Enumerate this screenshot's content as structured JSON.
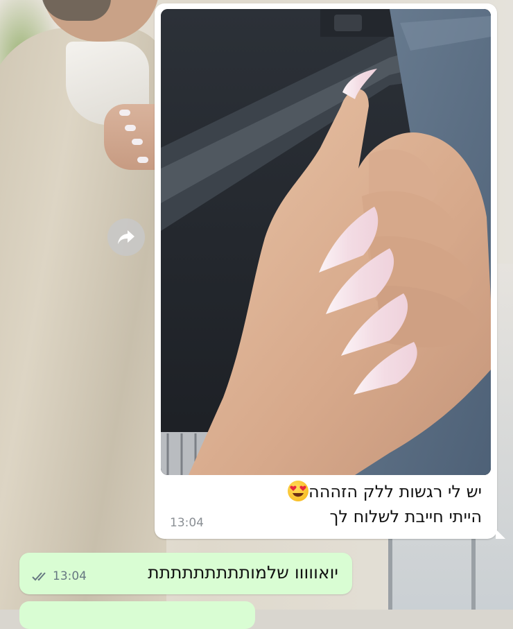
{
  "incoming": {
    "caption_line1": "יש לי רגשות ללק הזההה",
    "caption_line2": "הייתי חייבת לשלוח לך",
    "time": "13:04",
    "emoji": "heart-eyes-emoji"
  },
  "outgoing": {
    "text": "יואווווו שלמותתתתתתתתת",
    "time": "13:04",
    "status": "read-double-check"
  },
  "colors": {
    "incoming_bubble": "#ffffff",
    "outgoing_bubble": "#d9fdd3",
    "read_ticks": "#53bdeb",
    "meta_text": "#667781"
  }
}
